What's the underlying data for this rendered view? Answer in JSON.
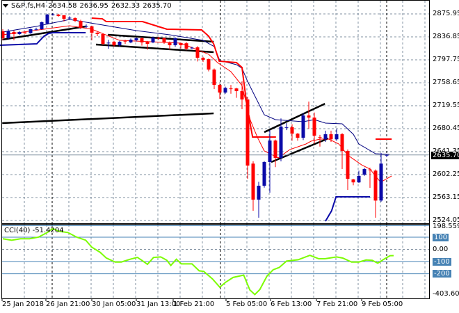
{
  "header": {
    "symbol": "S&P,fs,H4",
    "open": "2634.58",
    "high": "2636.95",
    "low": "2632.33",
    "close": "2635.70"
  },
  "price_axis": {
    "ticks": [
      "2875.95",
      "2836.85",
      "2797.75",
      "2758.65",
      "2719.55",
      "2680.45",
      "2641.35",
      "2602.25",
      "2563.15",
      "2524.05"
    ],
    "current_price": "2635.70"
  },
  "cci_panel": {
    "label": "CCI(40)",
    "value": "-51.4204",
    "max_label": "198.5593",
    "min_label": "-403.6083",
    "levels": [
      "100",
      "0.00",
      "-100",
      "-200"
    ]
  },
  "time_axis": {
    "labels": [
      "25 Jan 2018",
      "26 Jan 21:00",
      "30 Jan 05:00",
      "31 Jan 13:00",
      "1 Feb 21:00",
      "5 Feb 05:00",
      "6 Feb 13:00",
      "7 Feb 21:00",
      "9 Feb 05:00"
    ]
  },
  "colors": {
    "bull": "#0a0aa8",
    "bear": "#ff0000",
    "ma_fast": "#ff0000",
    "ma_slow": "#000080",
    "cci": "#7cfc00",
    "level": "#4682b4",
    "trend": "#000000"
  },
  "chart_data": [
    {
      "type": "candlestick",
      "title": "S&P,fs,H4",
      "ylim": [
        2524.05,
        2875.95
      ],
      "candle_format": "[open, high, low, close]",
      "candles": [
        [
          2846.3,
          2849.9,
          2830.9,
          2834.5
        ],
        [
          2834.5,
          2849.9,
          2832,
          2846.3
        ],
        [
          2845.2,
          2848,
          2830.9,
          2841.6
        ],
        [
          2841.6,
          2847,
          2840,
          2845.2
        ],
        [
          2844.5,
          2846,
          2842,
          2843.0
        ],
        [
          2843.0,
          2851,
          2842,
          2849.9
        ],
        [
          2849.5,
          2852.5,
          2848,
          2850.2
        ],
        [
          2849.9,
          2863,
          2849,
          2861.8
        ],
        [
          2859.4,
          2876,
          2858,
          2874.8
        ],
        [
          2874.5,
          2877,
          2873,
          2875
        ],
        [
          2874.8,
          2876,
          2871,
          2872.4
        ],
        [
          2873.6,
          2874,
          2863,
          2867.7
        ],
        [
          2868.5,
          2872,
          2866,
          2869.5
        ],
        [
          2868.9,
          2870,
          2862,
          2864.1
        ],
        [
          2864.1,
          2866,
          2850,
          2852.3
        ],
        [
          2854.2,
          2858,
          2852,
          2855.2
        ],
        [
          2854.7,
          2856,
          2830.9,
          2844
        ],
        [
          2844,
          2845,
          2838,
          2841.6
        ],
        [
          2841.6,
          2843,
          2823,
          2825
        ],
        [
          2826,
          2832,
          2816.7,
          2827
        ],
        [
          2828.6,
          2830,
          2820,
          2822.6
        ],
        [
          2822.6,
          2830,
          2820,
          2828.6
        ],
        [
          2830,
          2832,
          2825,
          2829
        ],
        [
          2827.4,
          2834,
          2826,
          2832
        ],
        [
          2831,
          2836,
          2829,
          2834.5
        ],
        [
          2834.5,
          2836,
          2822,
          2827.4
        ],
        [
          2828.6,
          2830,
          2815,
          2825
        ],
        [
          2827.4,
          2837,
          2826,
          2835.7
        ],
        [
          2835,
          2837,
          2832,
          2834
        ],
        [
          2834.5,
          2836,
          2825,
          2827.4
        ],
        [
          2827.4,
          2829,
          2815,
          2822.6
        ],
        [
          2822.6,
          2836,
          2820,
          2834.5
        ],
        [
          2826,
          2827,
          2817,
          2822.6
        ],
        [
          2826,
          2828,
          2814,
          2816.7
        ],
        [
          2817.5,
          2820,
          2816,
          2818.5
        ],
        [
          2819,
          2821,
          2795,
          2801.3
        ],
        [
          2801.3,
          2803,
          2794,
          2797.7
        ],
        [
          2798.9,
          2800,
          2778,
          2781.2
        ],
        [
          2781.2,
          2783,
          2748,
          2755
        ],
        [
          2755,
          2757,
          2731.4,
          2742
        ],
        [
          2742,
          2752,
          2740,
          2750
        ],
        [
          2749,
          2755,
          2740,
          2748
        ],
        [
          2749,
          2750,
          2733,
          2744.4
        ],
        [
          2744.4,
          2761,
          2713.6,
          2730.2
        ],
        [
          2730.2,
          2735,
          2595,
          2617.6
        ],
        [
          2621,
          2625,
          2540.6,
          2559.6
        ],
        [
          2559.6,
          2590,
          2528.8,
          2583.3
        ],
        [
          2583.3,
          2625,
          2580,
          2623.6
        ],
        [
          2623.6,
          2678,
          2571.5,
          2660.3
        ],
        [
          2660.3,
          2662,
          2615,
          2630.7
        ],
        [
          2630.7,
          2698,
          2624.8,
          2684
        ],
        [
          2682,
          2690,
          2678,
          2683
        ],
        [
          2683,
          2688,
          2660,
          2672
        ],
        [
          2672,
          2673,
          2660,
          2665
        ],
        [
          2665,
          2707,
          2661,
          2703
        ],
        [
          2703,
          2726.6,
          2680,
          2699.4
        ],
        [
          2699.4,
          2708,
          2655,
          2668.6
        ],
        [
          2666,
          2670,
          2650,
          2665
        ],
        [
          2662.4,
          2677,
          2658,
          2671
        ],
        [
          2671,
          2677,
          2658,
          2662.4
        ],
        [
          2662.4,
          2680,
          2660,
          2671
        ],
        [
          2671,
          2673,
          2611.7,
          2642.6
        ],
        [
          2642.6,
          2645,
          2576.2,
          2595
        ],
        [
          2594,
          2595,
          2584,
          2589
        ],
        [
          2589,
          2609,
          2588,
          2600
        ],
        [
          2602,
          2614,
          2600,
          2611.7
        ],
        [
          2611,
          2614,
          2579.8,
          2610
        ],
        [
          2609,
          2611,
          2528.8,
          2558
        ],
        [
          2558,
          2639,
          2556,
          2621
        ],
        [
          2634.58,
          2636.95,
          2632.33,
          2635.7
        ]
      ],
      "overlays": [
        {
          "name": "ma-slow",
          "color_key": "ma_slow",
          "width": 1,
          "points": [
            [
              0,
              2845.2
            ],
            [
              6,
              2854.6
            ],
            [
              12,
              2866.5
            ],
            [
              18,
              2857
            ],
            [
              24,
              2847.5
            ],
            [
              30,
              2840.4
            ],
            [
              36,
              2830.9
            ],
            [
              38,
              2820.3
            ],
            [
              39,
              2796.6
            ],
            [
              42,
              2789.5
            ],
            [
              43,
              2783.5
            ],
            [
              44,
              2761
            ],
            [
              47,
              2704.2
            ],
            [
              49,
              2695.9
            ],
            [
              54,
              2692.3
            ],
            [
              56,
              2695.9
            ],
            [
              58,
              2690
            ],
            [
              61,
              2688.8
            ],
            [
              63,
              2671
            ],
            [
              64,
              2654.4
            ],
            [
              67,
              2637.8
            ],
            [
              69.5,
              2636.6
            ]
          ]
        },
        {
          "name": "ma-fast",
          "color_key": "ma_fast",
          "width": 1,
          "points": [
            [
              0,
              2840.4
            ],
            [
              12,
              2855.8
            ],
            [
              16,
              2849.9
            ],
            [
              21,
              2830.9
            ],
            [
              32,
              2826.2
            ],
            [
              37,
              2807.2
            ],
            [
              38.6,
              2793
            ],
            [
              41,
              2777.6
            ],
            [
              43,
              2753.9
            ],
            [
              44.5,
              2694.7
            ],
            [
              45.75,
              2666.2
            ],
            [
              47,
              2642.6
            ],
            [
              49.5,
              2630.7
            ],
            [
              51.6,
              2644.9
            ],
            [
              54.5,
              2654.4
            ],
            [
              55.4,
              2659.1
            ],
            [
              57,
              2662.7
            ],
            [
              58.6,
              2662.7
            ],
            [
              60.4,
              2654.4
            ],
            [
              62,
              2635.4
            ],
            [
              64.5,
              2618.8
            ],
            [
              66,
              2611.7
            ],
            [
              67.9,
              2589.2
            ],
            [
              69.9,
              2599.9
            ]
          ]
        },
        {
          "name": "upper-band",
          "color_key": "bear",
          "width": 2,
          "points": [
            [
              16,
              2868.8
            ],
            [
              17.9,
              2867.6
            ],
            [
              18.6,
              2862.9
            ],
            [
              25.1,
              2862.9
            ],
            [
              29.5,
              2849.9
            ],
            [
              35.75,
              2848.7
            ],
            [
              37,
              2838
            ],
            [
              37.9,
              2825
            ],
            [
              38.9,
              2795.4
            ],
            [
              42,
              2793
            ],
            [
              43,
              2784.7
            ],
            [
              43.25,
              2765.7
            ],
            [
              43.9,
              2718.4
            ],
            [
              44.9,
              2666.2
            ],
            [
              49.1,
              2666.2
            ]
          ]
        },
        {
          "name": "upper-band-2",
          "color_key": "bear",
          "width": 2,
          "points": [
            [
              67,
              2662.7
            ],
            [
              69.9,
              2662.7
            ]
          ]
        },
        {
          "name": "lower-band",
          "color_key": "bull",
          "width": 2,
          "points": [
            [
              -0.5,
              2822.6
            ],
            [
              6.1,
              2825
            ],
            [
              7.4,
              2838
            ],
            [
              8.25,
              2842.8
            ],
            [
              9.1,
              2844
            ],
            [
              14.9,
              2844
            ]
          ]
        },
        {
          "name": "lower-band-2",
          "color_key": "bull",
          "width": 2,
          "points": [
            [
              58,
              2522.9
            ],
            [
              59.1,
              2540.6
            ],
            [
              59.9,
              2564.3
            ],
            [
              66,
              2564.3
            ]
          ]
        }
      ],
      "trendlines": [
        [
          [
            -0.1,
            2832.1
          ],
          [
            14.9,
            2854.6
          ]
        ],
        [
          [
            18.9,
            2840.4
          ],
          [
            37.9,
            2828.6
          ]
        ],
        [
          [
            16.75,
            2823.8
          ],
          [
            37.9,
            2810.8
          ]
        ],
        [
          [
            -0.1,
            2689.9
          ],
          [
            37.9,
            2706.5
          ]
        ],
        [
          [
            47,
            2674.5
          ],
          [
            57.9,
            2723
          ]
        ],
        [
          [
            48.25,
            2623.6
          ],
          [
            58.5,
            2663.9
          ]
        ]
      ]
    },
    {
      "type": "line",
      "title": "CCI(40)",
      "ylim": [
        -403.6083,
        198.5593
      ],
      "levels": [
        100,
        0,
        -100,
        -200
      ],
      "points": [
        [
          0,
          87
        ],
        [
          1.6,
          75
        ],
        [
          3.2,
          87
        ],
        [
          4.8,
          87
        ],
        [
          6.4,
          100
        ],
        [
          8,
          138
        ],
        [
          8.95,
          170
        ],
        [
          10.1,
          148
        ],
        [
          11.7,
          138
        ],
        [
          13.3,
          100
        ],
        [
          14.9,
          75
        ],
        [
          16,
          18
        ],
        [
          17.5,
          -24
        ],
        [
          18.6,
          -71
        ],
        [
          20.2,
          -104
        ],
        [
          21.3,
          -104
        ],
        [
          22.9,
          -81
        ],
        [
          24.2,
          -66
        ],
        [
          25,
          -90
        ],
        [
          26,
          -123
        ],
        [
          27.1,
          -66
        ],
        [
          28.4,
          -62
        ],
        [
          29.5,
          -90
        ],
        [
          30.2,
          -132
        ],
        [
          31.2,
          -81
        ],
        [
          32.1,
          -119
        ],
        [
          34,
          -119
        ],
        [
          35.3,
          -176
        ],
        [
          36.1,
          -180
        ],
        [
          37.7,
          -243
        ],
        [
          39,
          -310
        ],
        [
          40.1,
          -268
        ],
        [
          41.4,
          -230
        ],
        [
          43.3,
          -211
        ],
        [
          44.4,
          -332
        ],
        [
          45.3,
          -370
        ],
        [
          46.2,
          -329
        ],
        [
          47.5,
          -218
        ],
        [
          48.6,
          -167
        ],
        [
          49.7,
          -148
        ],
        [
          51,
          -96
        ],
        [
          53.1,
          -85
        ],
        [
          55.2,
          -49
        ],
        [
          56.8,
          -77
        ],
        [
          57.9,
          -77
        ],
        [
          60,
          -62
        ],
        [
          61.1,
          -71
        ],
        [
          62.7,
          -104
        ],
        [
          64,
          -104
        ],
        [
          65.3,
          -87
        ],
        [
          66.4,
          -90
        ],
        [
          67.4,
          -113
        ],
        [
          68.5,
          -81
        ],
        [
          69.6,
          -52
        ],
        [
          70.5,
          -51.42
        ]
      ]
    }
  ]
}
